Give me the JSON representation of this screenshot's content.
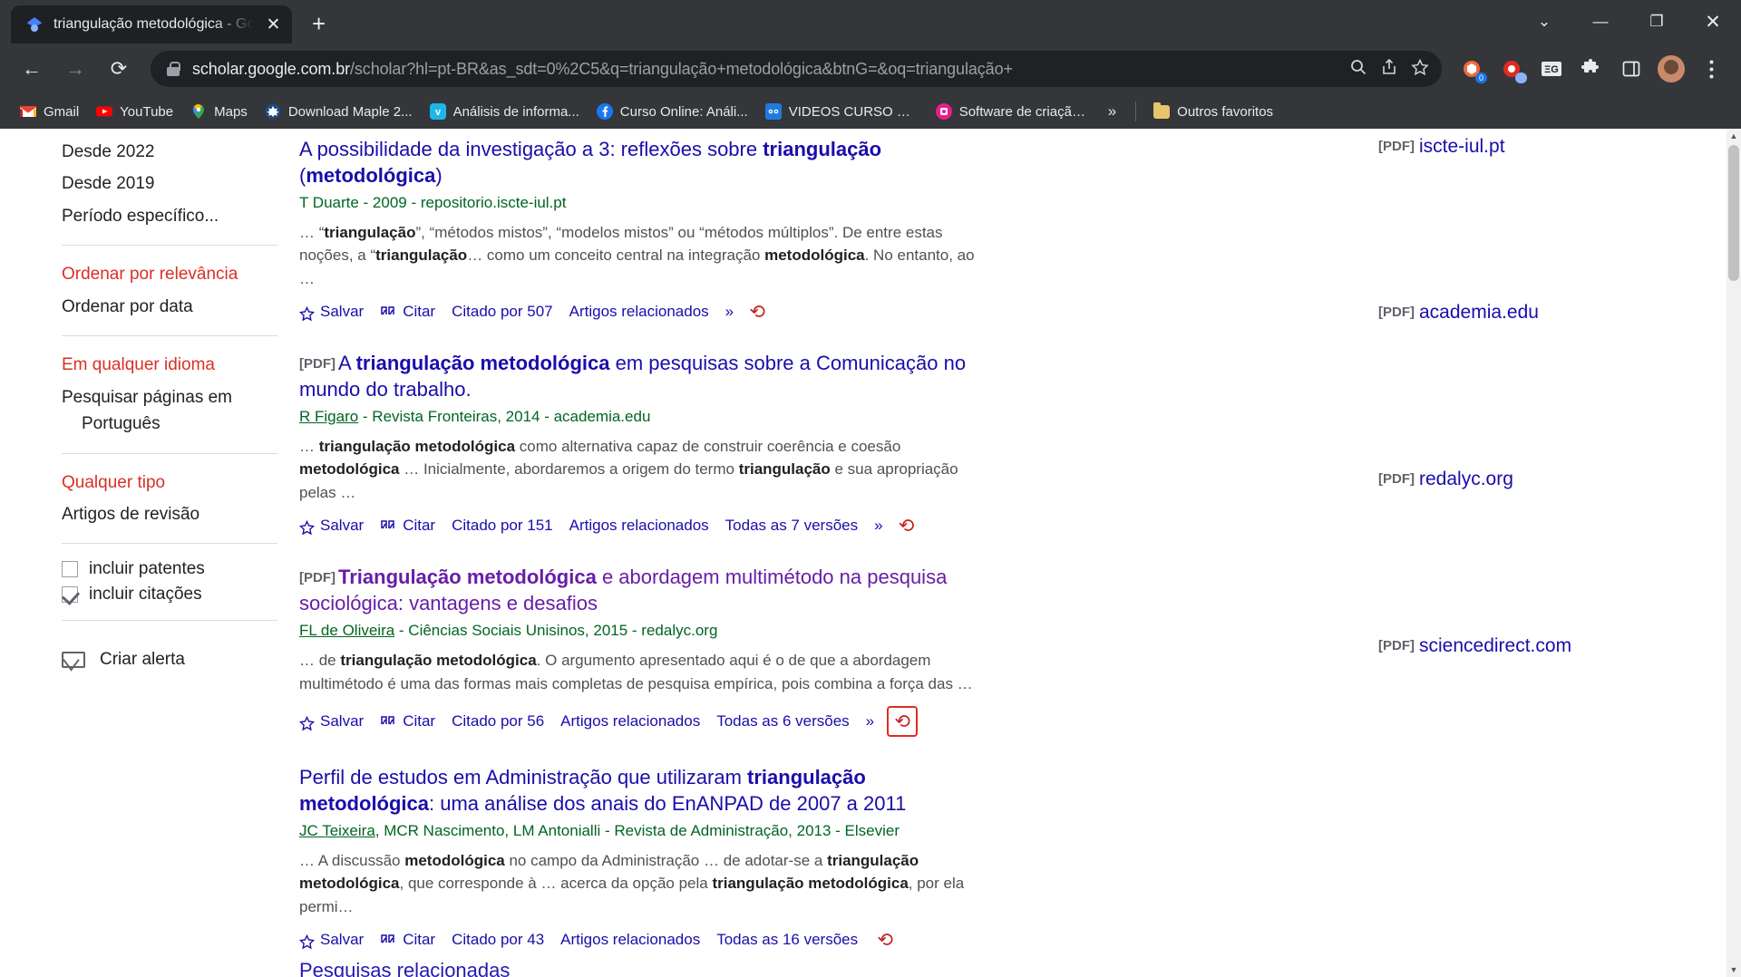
{
  "browser": {
    "tab": {
      "title": "triangulação metodológica - Goo",
      "favicon": "google-scholar-icon",
      "close_label": "✕"
    },
    "newtab_label": "+",
    "window_controls": {
      "minimize": "—",
      "maximize": "❐",
      "close": "✕",
      "chevron": "⌄"
    },
    "nav": {
      "back": "←",
      "forward": "→",
      "reload": "⟳"
    },
    "omnibox": {
      "host": "scholar.google.com.br",
      "path": "/scholar?hl=pt-BR&as_sdt=0%2C5&q=triangulação+metodológica&btnG=&oq=triangulação+",
      "lock_icon": "lock-icon",
      "search_icon": "search-icon",
      "share_icon": "share-icon",
      "bookmark_icon": "star-icon"
    },
    "toolbar_icons": [
      "extension-badge-icon",
      "extension-red-icon",
      "grammar-extension-icon",
      "puzzle-icon",
      "sidepanel-icon",
      "profile-avatar",
      "menu-icon"
    ],
    "extension_badge_count": "0",
    "bookmarks": [
      {
        "label": "Gmail",
        "icon": "gmail-icon"
      },
      {
        "label": "YouTube",
        "icon": "youtube-icon"
      },
      {
        "label": "Maps",
        "icon": "maps-icon"
      },
      {
        "label": "Download Maple 2...",
        "icon": "maple-icon"
      },
      {
        "label": "Análisis de informa...",
        "icon": "vimeo-icon"
      },
      {
        "label": "Curso Online: Análi...",
        "icon": "facebook-icon"
      },
      {
        "label": "VIDEOS CURSO NVI...",
        "icon": "video-icon"
      },
      {
        "label": "Software de criação...",
        "icon": "pink-app-icon"
      }
    ],
    "bookmarks_overflow": "»",
    "other_bookmarks": "Outros favoritos"
  },
  "sidebar": {
    "date_items": [
      {
        "label": "Desde 2022",
        "selected": false
      },
      {
        "label": "Desde 2019",
        "selected": false
      },
      {
        "label": "Período específico...",
        "selected": false
      }
    ],
    "sort_items": [
      {
        "label": "Ordenar por relevância",
        "selected": true
      },
      {
        "label": "Ordenar por data",
        "selected": false
      }
    ],
    "lang_items": [
      {
        "label": "Em qualquer idioma",
        "selected": true
      },
      {
        "label": "Pesquisar páginas em Português",
        "selected": false
      }
    ],
    "type_items": [
      {
        "label": "Qualquer tipo",
        "selected": true
      },
      {
        "label": "Artigos de revisão",
        "selected": false
      }
    ],
    "checkboxes": [
      {
        "label": "incluir patentes",
        "checked": false
      },
      {
        "label": "incluir citações",
        "checked": true
      }
    ],
    "alert": {
      "label": "Criar alerta",
      "icon": "envelope-icon"
    }
  },
  "results": [
    {
      "tag": "",
      "title_parts": [
        {
          "t": "A possibilidade da investigação a 3: reflexões sobre ",
          "b": false
        },
        {
          "t": "triangulação",
          "b": true
        },
        {
          "t": " (",
          "b": false
        },
        {
          "t": "metodológica",
          "b": true
        },
        {
          "t": ")",
          "b": false
        }
      ],
      "visited": false,
      "meta": "T Duarte - 2009 - repositorio.iscte-iul.pt",
      "author_link": "",
      "snippet_parts": [
        {
          "t": "… “",
          "b": false
        },
        {
          "t": "triangulação",
          "b": true
        },
        {
          "t": "”, “métodos mistos”, “modelos mistos” ou “métodos múltiplos”. De entre estas noções, a “",
          "b": false
        },
        {
          "t": "triangulação",
          "b": true
        },
        {
          "t": "… como um conceito central na integração ",
          "b": false
        },
        {
          "t": "metodológica",
          "b": true
        },
        {
          "t": ". No entanto, ao …",
          "b": false
        }
      ],
      "links": {
        "save": "Salvar",
        "cite": "Citar",
        "cited_by": "Citado por 507",
        "related": "Artigos relacionados",
        "versions": "",
        "chevrons": "»",
        "flag": "⟲",
        "flag_boxed": false
      },
      "right": {
        "prefix": "[PDF]",
        "label": "iscte-iul.pt"
      }
    },
    {
      "tag": "[PDF]",
      "title_parts": [
        {
          "t": "A ",
          "b": false
        },
        {
          "t": "triangulação metodológica",
          "b": true
        },
        {
          "t": " em pesquisas sobre a Comunicação no mundo do trabalho.",
          "b": false
        }
      ],
      "visited": false,
      "meta": " - Revista Fronteiras, 2014 - academia.edu",
      "author_link": "R Figaro",
      "snippet_parts": [
        {
          "t": "… ",
          "b": false
        },
        {
          "t": "triangulação metodológica",
          "b": true
        },
        {
          "t": " como alternativa capaz de construir coerência e coesão ",
          "b": false
        },
        {
          "t": "metodológica",
          "b": true
        },
        {
          "t": " … Inicialmente, abordaremos a origem do termo ",
          "b": false
        },
        {
          "t": "triangulação",
          "b": true
        },
        {
          "t": " e sua apropriação pelas …",
          "b": false
        }
      ],
      "links": {
        "save": "Salvar",
        "cite": "Citar",
        "cited_by": "Citado por 151",
        "related": "Artigos relacionados",
        "versions": "Todas as 7 versões",
        "chevrons": "»",
        "flag": "⟲",
        "flag_boxed": false
      },
      "right": {
        "prefix": "[PDF]",
        "label": "academia.edu"
      }
    },
    {
      "tag": "[PDF]",
      "title_parts": [
        {
          "t": "Triangulação metodológica",
          "b": true
        },
        {
          "t": " e abordagem multimétodo na pesquisa sociológica: vantagens e desafios",
          "b": false
        }
      ],
      "visited": true,
      "meta": " - Ciências Sociais Unisinos, 2015 - redalyc.org",
      "author_link": "FL de Oliveira",
      "snippet_parts": [
        {
          "t": "… de ",
          "b": false
        },
        {
          "t": "triangulação metodológica",
          "b": true
        },
        {
          "t": ". O argumento apresentado aqui é o de que a abordagem multimétodo é uma das formas mais completas de pesquisa empírica, pois combina a força das …",
          "b": false
        }
      ],
      "links": {
        "save": "Salvar",
        "cite": "Citar",
        "cited_by": "Citado por 56",
        "related": "Artigos relacionados",
        "versions": "Todas as 6 versões",
        "chevrons": "»",
        "flag": "⟲",
        "flag_boxed": true
      },
      "right": {
        "prefix": "[PDF]",
        "label": "redalyc.org"
      }
    },
    {
      "tag": "",
      "title_parts": [
        {
          "t": "Perfil de estudos em Administração que utilizaram ",
          "b": false
        },
        {
          "t": "triangulação metodológica",
          "b": true
        },
        {
          "t": ": uma análise dos anais do EnANPAD de 2007 a 2011",
          "b": false
        }
      ],
      "visited": false,
      "meta": ", MCR Nascimento, LM Antonialli - Revista de Administração, 2013 - Elsevier",
      "author_link": "JC Teixeira",
      "snippet_parts": [
        {
          "t": "… A discussão ",
          "b": false
        },
        {
          "t": "metodológica",
          "b": true
        },
        {
          "t": " no campo da Administração … de adotar-se a ",
          "b": false
        },
        {
          "t": "triangulação metodológica",
          "b": true
        },
        {
          "t": ", que corresponde à … acerca da opção pela ",
          "b": false
        },
        {
          "t": "triangulação metodológica",
          "b": true
        },
        {
          "t": ", por ela permi…",
          "b": false
        }
      ],
      "links": {
        "save": "Salvar",
        "cite": "Citar",
        "cited_by": "Citado por 43",
        "related": "Artigos relacionados",
        "versions": "Todas as 16 versões",
        "chevrons": "",
        "flag": "⟲",
        "flag_boxed": false
      },
      "right": {
        "prefix": "[PDF]",
        "label": "sciencedirect.com"
      }
    }
  ],
  "bottom_teaser": "Pesquisas relacionadas",
  "colors": {
    "link": "#1a0dab",
    "visited": "#681da8",
    "green": "#006621",
    "red": "#d93025",
    "chrome_bg": "#35363a",
    "tab_bg": "#1f2023"
  }
}
